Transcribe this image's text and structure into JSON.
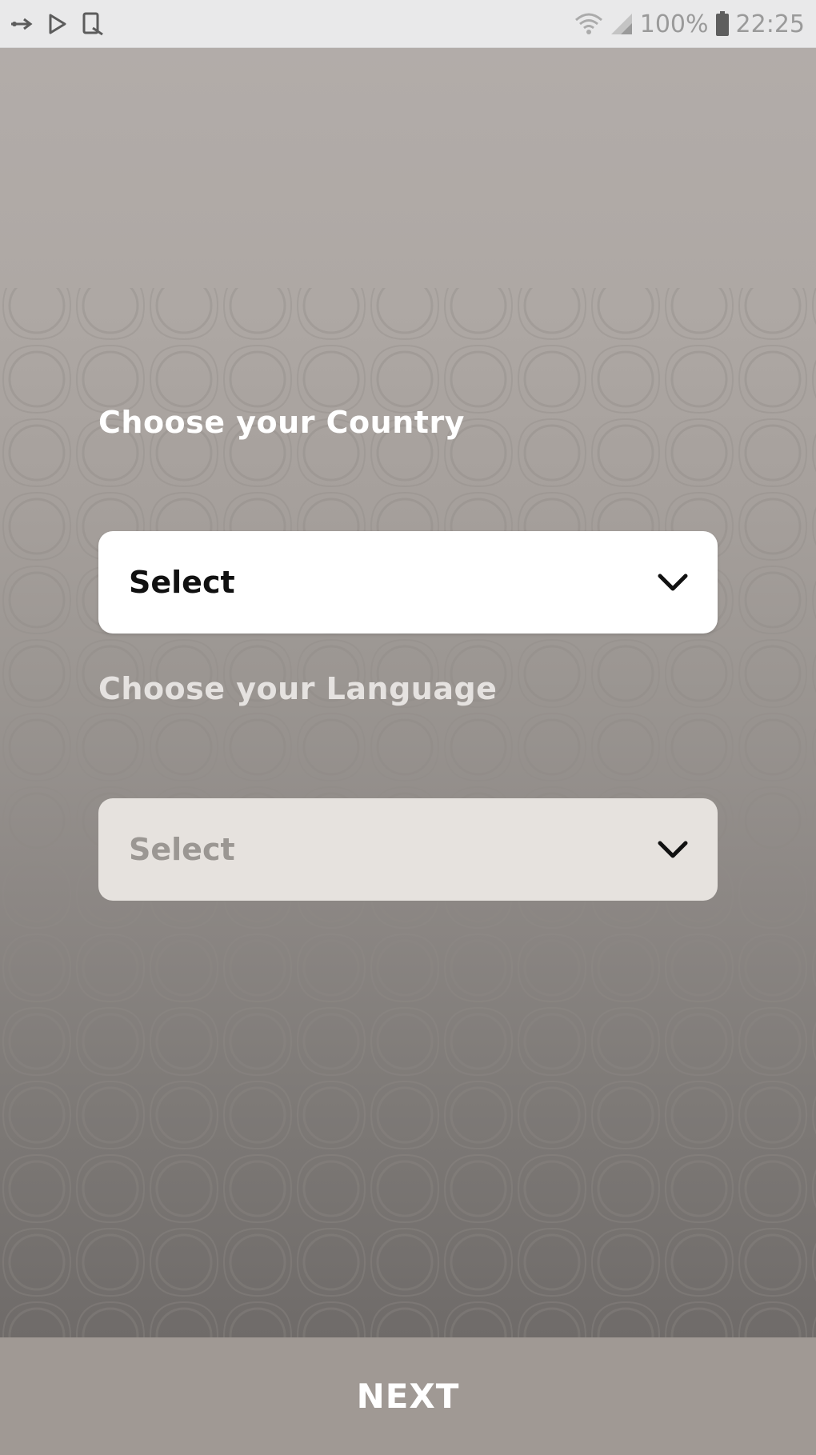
{
  "status_bar": {
    "left_icons": [
      "usb-debug-icon",
      "play-store-icon",
      "screenshot-notification-icon"
    ],
    "right_icons": [
      "wifi-icon",
      "signal-icon",
      "battery-icon"
    ],
    "battery": "100%",
    "time": "22:25"
  },
  "form": {
    "country": {
      "label": "Choose your Country",
      "value": "Select"
    },
    "language": {
      "label": "Choose your Language",
      "value": "Select"
    }
  },
  "footer": {
    "next_label": "NEXT"
  },
  "colors": {
    "next_bar": "#a09994",
    "country_select_bg": "#ffffff",
    "language_select_bg": "#e6e2de"
  }
}
